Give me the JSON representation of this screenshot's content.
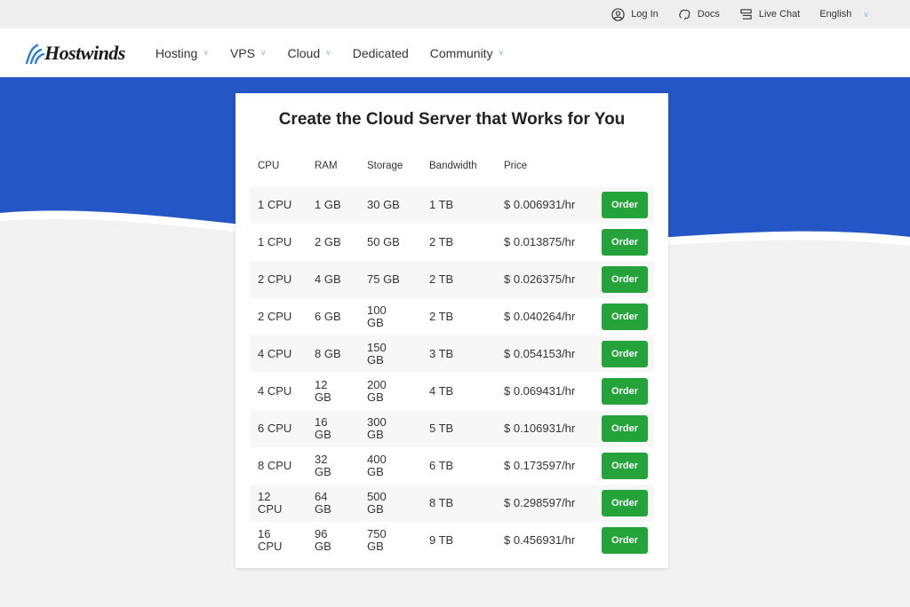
{
  "topbar": {
    "login": "Log In",
    "docs": "Docs",
    "live_chat": "Live Chat",
    "language": "English"
  },
  "nav": {
    "logo": "Hostwinds",
    "items": [
      {
        "label": "Hosting",
        "dropdown": true
      },
      {
        "label": "VPS",
        "dropdown": true
      },
      {
        "label": "Cloud",
        "dropdown": true
      },
      {
        "label": "Dedicated",
        "dropdown": false
      },
      {
        "label": "Community",
        "dropdown": true
      }
    ]
  },
  "colors": {
    "brand_blue": "#2457c5",
    "order_green": "#24a33a"
  },
  "card": {
    "title": "Create the Cloud Server that Works for You",
    "headers": [
      "CPU",
      "RAM",
      "Storage",
      "Bandwidth",
      "Price"
    ],
    "order_label": "Order",
    "rows": [
      [
        "1 CPU",
        "1 GB",
        "30 GB",
        "1 TB",
        "$ 0.006931/hr"
      ],
      [
        "1 CPU",
        "2 GB",
        "50 GB",
        "2 TB",
        "$ 0.013875/hr"
      ],
      [
        "2 CPU",
        "4 GB",
        "75 GB",
        "2 TB",
        "$ 0.026375/hr"
      ],
      [
        "2 CPU",
        "6 GB",
        "100 GB",
        "2 TB",
        "$ 0.040264/hr"
      ],
      [
        "4 CPU",
        "8 GB",
        "150 GB",
        "3 TB",
        "$ 0.054153/hr"
      ],
      [
        "4 CPU",
        "12 GB",
        "200 GB",
        "4 TB",
        "$ 0.069431/hr"
      ],
      [
        "6 CPU",
        "16 GB",
        "300 GB",
        "5 TB",
        "$ 0.106931/hr"
      ],
      [
        "8 CPU",
        "32 GB",
        "400 GB",
        "6 TB",
        "$ 0.173597/hr"
      ],
      [
        "12 CPU",
        "64 GB",
        "500 GB",
        "8 TB",
        "$ 0.298597/hr"
      ],
      [
        "16 CPU",
        "96 GB",
        "750 GB",
        "9 TB",
        "$ 0.456931/hr"
      ]
    ]
  }
}
